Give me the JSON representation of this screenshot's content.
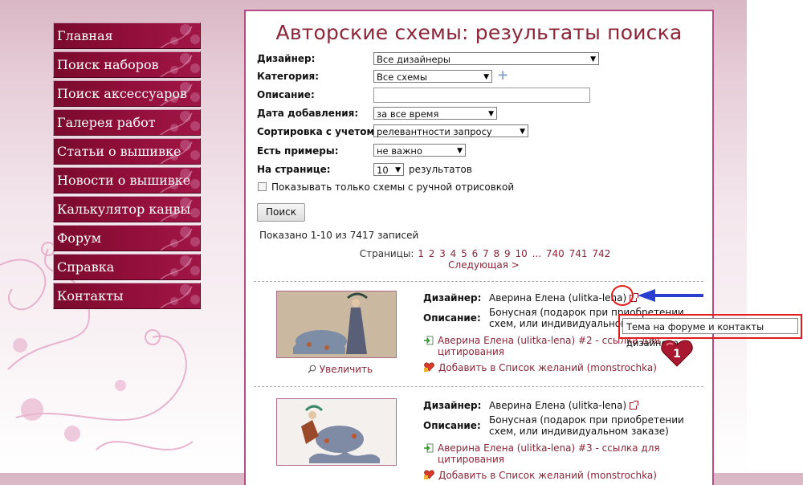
{
  "menu": [
    "Главная",
    "Поиск наборов",
    "Поиск аксессуаров",
    "Галерея работ",
    "Статьи о вышивке",
    "Новости о вышивке",
    "Калькулятор канвы",
    "Форум",
    "Справка",
    "Контакты"
  ],
  "page": {
    "title": "Авторские схемы: результаты поиска"
  },
  "form": {
    "designer": {
      "label": "Дизайнер:",
      "value": "Все дизайнеры"
    },
    "category": {
      "label": "Категория:",
      "value": "Все схемы"
    },
    "description": {
      "label": "Описание:",
      "value": ""
    },
    "date": {
      "label": "Дата добавления:",
      "value": "за все время"
    },
    "sort": {
      "label": "Сортировка с учетом:",
      "value": "релевантности запросу"
    },
    "examples": {
      "label": "Есть примеры:",
      "value": "не важно"
    },
    "per_page": {
      "label": "На странице:",
      "value": "10",
      "suffix": "результатов"
    },
    "handdrawn_checkbox": {
      "label": "Показывать только схемы с ручной отрисовкой",
      "checked": false
    },
    "search_button": "Поиск"
  },
  "results": {
    "summary": "Показано 1-10 из 7417 записей",
    "pager_label": "Страницы:",
    "pages": [
      "1",
      "2",
      "3",
      "4",
      "5",
      "6",
      "7",
      "8",
      "9",
      "10",
      "...",
      "740",
      "741",
      "742"
    ],
    "next": "Следующая >"
  },
  "items": [
    {
      "designer_label": "Дизайнер:",
      "designer": "Аверина Елена (ulitka-lena)",
      "desc_label": "Описание:",
      "desc": [
        "Бонусная (подарок при приобретении",
        "схем, или индивидуальном з"
      ],
      "cite_link": [
        "Аверина Елена (ulitka-lena) #2 - ссылка для",
        "цитирования"
      ],
      "wish_link": "Добавить в Список желаний (monstrochka)",
      "zoom": "Увеличить"
    },
    {
      "designer_label": "Дизайнер:",
      "designer": "Аверина Елена (ulitka-lena)",
      "desc_label": "Описание:",
      "desc": [
        "Бонусная (подарок при приобретении",
        "схем, или индивидуальном заказе)"
      ],
      "cite_link": [
        "Аверина Елена (ulitka-lena) #3 - ссылка для",
        "цитирования"
      ],
      "wish_link": "Добавить в Список желаний (monstrochka)",
      "zoom": "Увеличить"
    }
  ],
  "tooltip": "Тема на форуме и контакты дизайнера",
  "badge_count": "1",
  "colors": {
    "accent": "#8b2538",
    "menu_bg": "#8a0d36",
    "panel_border": "#b34d86",
    "annotation_red": "#e31c1c",
    "annotation_blue": "#2a3fd0"
  }
}
